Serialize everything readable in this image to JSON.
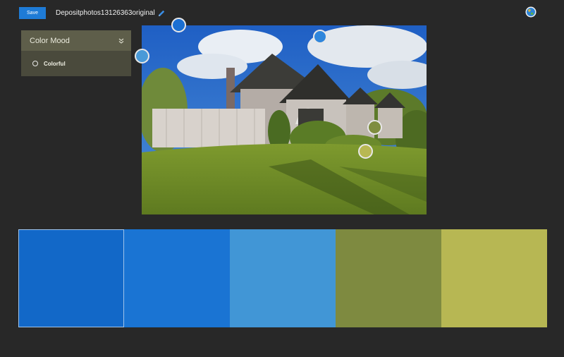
{
  "toolbar": {
    "save_label": "Save",
    "document_title": "Depositphotos13126363original"
  },
  "mood_panel": {
    "title": "Color Mood",
    "option_label": "Colorful"
  },
  "photo": {
    "subject": "suburban house with lawn"
  },
  "color_pickers": [
    {
      "color": "#1b6fd2"
    },
    {
      "color": "#2f86dc"
    },
    {
      "color": "#4a9ad8"
    },
    {
      "color": "#7f8d3f"
    },
    {
      "color": "#b8b852"
    }
  ],
  "swatches": [
    {
      "color": "#1268c8",
      "selected": true
    },
    {
      "color": "#1a74d3",
      "selected": false
    },
    {
      "color": "#4196d6",
      "selected": false
    },
    {
      "color": "#7e8a40",
      "selected": false
    },
    {
      "color": "#b7b753",
      "selected": false
    }
  ],
  "icons": {
    "edit": "pencil-icon",
    "account": "globe-icon",
    "expand": "double-chevron-down-icon",
    "radio": "radio-unselected-icon"
  }
}
